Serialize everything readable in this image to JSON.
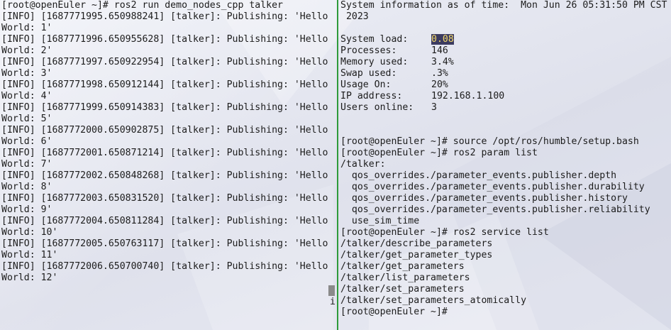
{
  "left_terminal": {
    "lines": [
      "[root@openEuler ~]# ros2 run demo_nodes_cpp talker",
      "[INFO] [1687771995.650988241] [talker]: Publishing: 'Hello",
      "World: 1'",
      "[INFO] [1687771996.650955628] [talker]: Publishing: 'Hello",
      "World: 2'",
      "[INFO] [1687771997.650922954] [talker]: Publishing: 'Hello",
      "World: 3'",
      "[INFO] [1687771998.650912144] [talker]: Publishing: 'Hello",
      "World: 4'",
      "[INFO] [1687771999.650914383] [talker]: Publishing: 'Hello",
      "World: 5'",
      "[INFO] [1687772000.650902875] [talker]: Publishing: 'Hello",
      "World: 6'",
      "[INFO] [1687772001.650871214] [talker]: Publishing: 'Hello",
      "World: 7'",
      "[INFO] [1687772002.650848268] [talker]: Publishing: 'Hello",
      "World: 8'",
      "[INFO] [1687772003.650831520] [talker]: Publishing: 'Hello",
      "World: 9'",
      "[INFO] [1687772004.650811284] [talker]: Publishing: 'Hello",
      "World: 10'",
      "[INFO] [1687772005.650763117] [talker]: Publishing: 'Hello",
      "World: 11'",
      "[INFO] [1687772006.650700740] [talker]: Publishing: 'Hello",
      "World: 12'"
    ],
    "scroll_glyph": "i"
  },
  "right_terminal": {
    "sysinfo_header_line1": "System information as of time:  Mon Jun 26 05:31:50 PM CST",
    "sysinfo_header_line2": " 2023",
    "sysinfo": [
      {
        "label": "System load:",
        "value": "0.08"
      },
      {
        "label": "Processes:",
        "value": "146"
      },
      {
        "label": "Memory used:",
        "value": "3.4%"
      },
      {
        "label": "Swap used:",
        "value": ".3%"
      },
      {
        "label": "Usage On:",
        "value": "20%"
      },
      {
        "label": "IP address:",
        "value": "192.168.1.100"
      },
      {
        "label": "Users online:",
        "value": "3"
      }
    ],
    "lines": [
      "[root@openEuler ~]# source /opt/ros/humble/setup.bash",
      "[root@openEuler ~]# ros2 param list",
      "/talker:",
      "  qos_overrides./parameter_events.publisher.depth",
      "  qos_overrides./parameter_events.publisher.durability",
      "  qos_overrides./parameter_events.publisher.history",
      "  qos_overrides./parameter_events.publisher.reliability",
      "  use_sim_time",
      "[root@openEuler ~]# ros2 service list",
      "/talker/describe_parameters",
      "/talker/get_parameter_types",
      "/talker/get_parameters",
      "/talker/list_parameters",
      "/talker/set_parameters",
      "/talker/set_parameters_atomically",
      "[root@openEuler ~]#"
    ]
  },
  "colors": {
    "divider": "#2e9a3a",
    "highlight_bg": "#3b3b60",
    "highlight_fg": "#f2d86a",
    "text": "#1c1c1c"
  }
}
